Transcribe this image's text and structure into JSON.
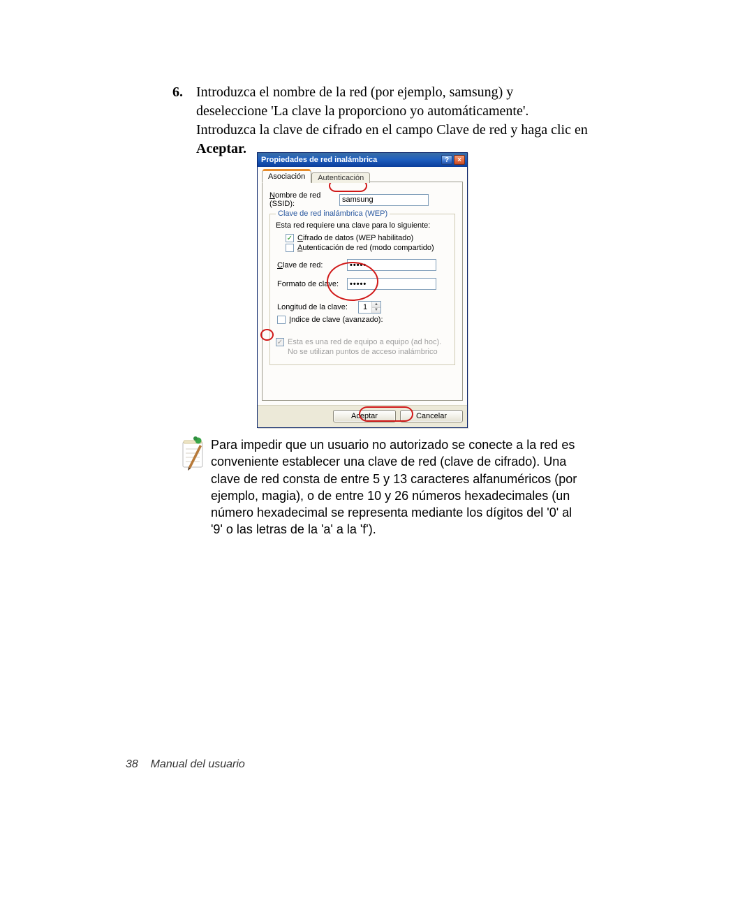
{
  "step": {
    "number": "6.",
    "text_before_bold": "Introduzca el nombre de la red (por ejemplo, samsung) y deseleccione 'La clave la proporciono yo automáticamente'. Introduzca la clave de cifrado en el campo Clave de red y haga clic en ",
    "bold": "Aceptar."
  },
  "dialog": {
    "title": "Propiedades de red inalámbrica",
    "help_glyph": "?",
    "close_glyph": "×",
    "tabs": {
      "association": "Asociación",
      "authentication": "Autenticación"
    },
    "ssid": {
      "label_u": "N",
      "label_rest": "ombre de red (SSID):",
      "value": "samsung"
    },
    "wep_group": {
      "legend": "Clave de red inalámbrica (WEP)",
      "intro": "Esta red requiere una clave para lo siguiente:",
      "data_cipher_u": "C",
      "data_cipher_rest": "ifrado de datos (WEP habilitado)",
      "auth_u": "A",
      "auth_rest": "utenticación de red (modo compartido)",
      "key_label_u": "C",
      "key_label_rest": "lave de red:",
      "key_value": "•••••",
      "format_label_u": "",
      "format_label": "Formato de clave:",
      "format_value": "•••••",
      "length_label": "Longitud de la clave:",
      "length_value": "1",
      "index_label_u": "I",
      "index_label_rest": "ndice de clave (avanzado):"
    },
    "adhoc": {
      "u": "E",
      "rest": "sta es una red de equipo a equipo (ad hoc). No se utilizan puntos de acceso inalámbrico"
    },
    "buttons": {
      "ok": "Aceptar",
      "cancel": "Cancelar"
    }
  },
  "note": {
    "text": "Para impedir que un usuario no autorizado se conecte a la red es conveniente establecer una clave de red (clave de cifrado). Una clave de red consta de entre 5 y 13 caracteres alfanuméricos (por ejemplo, magia), o de entre 10 y 26 números hexadecimales (un número hexadecimal se representa mediante los dígitos del '0' al '9' o las letras de la 'a' a la 'f')."
  },
  "footer": {
    "page": "38",
    "label": "Manual del usuario"
  }
}
